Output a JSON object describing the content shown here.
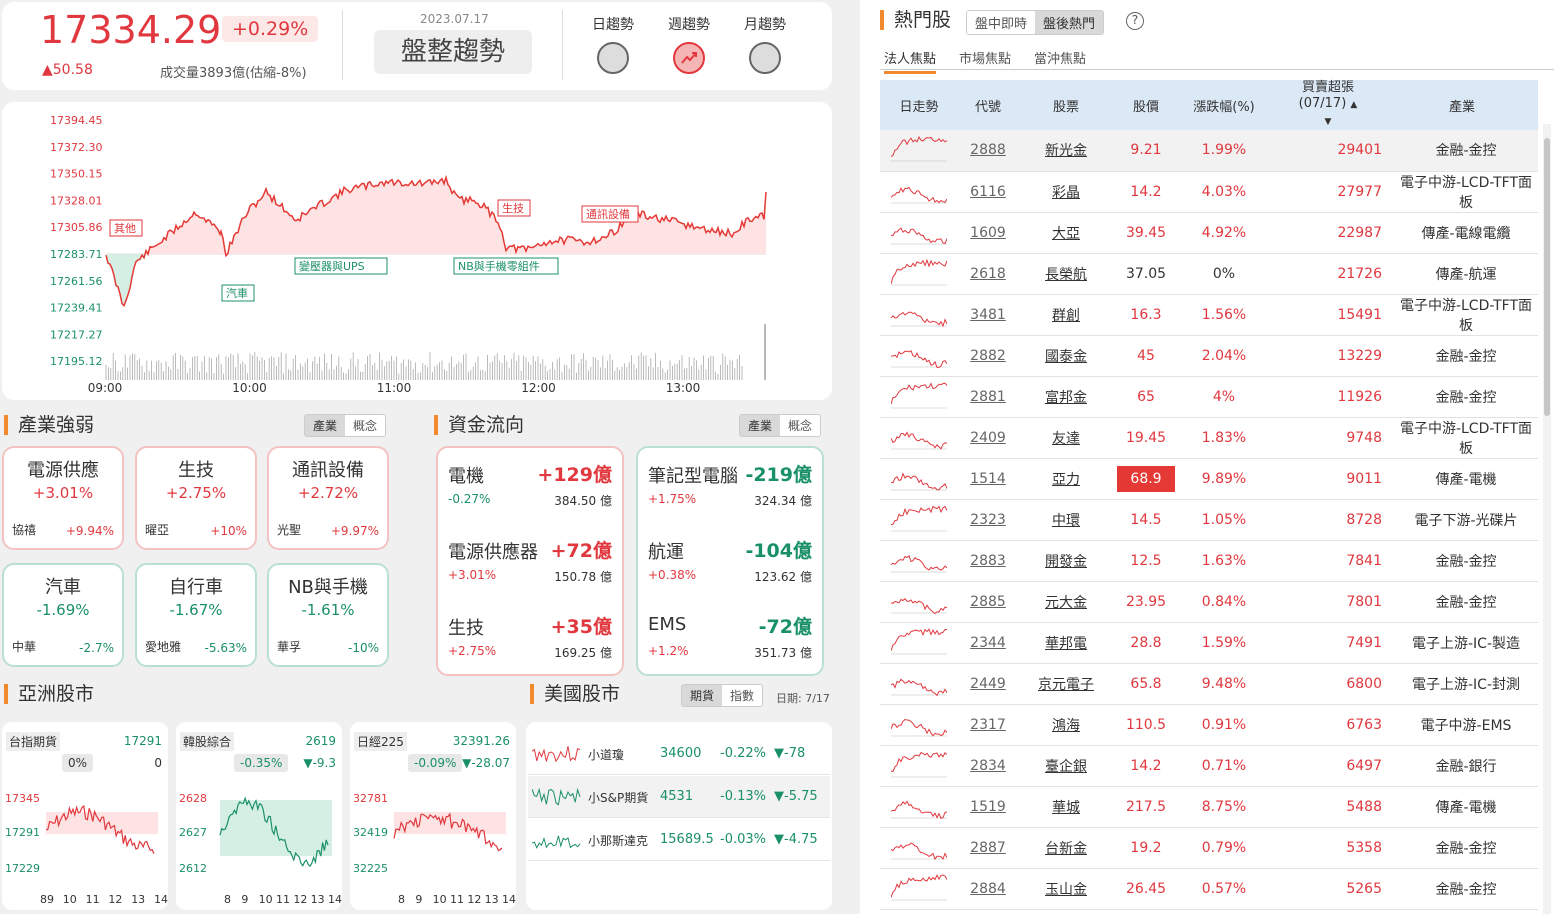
{
  "index": {
    "value": "17334.29",
    "pct": "+0.29%",
    "change": "▲50.58",
    "volume": "成交量3893億(估縮-8%)",
    "date": "2023.07.17",
    "trend_label": "盤整趨勢",
    "trend_tabs": [
      {
        "label": "日趨勢"
      },
      {
        "label": "週趨勢"
      },
      {
        "label": "月趨勢"
      }
    ]
  },
  "intraday": {
    "y_ticks": [
      "17394.45",
      "17372.30",
      "17350.15",
      "17328.01",
      "17305.86",
      "17283.71",
      "17261.56",
      "17239.41",
      "17217.27",
      "17195.12"
    ],
    "x_ticks": [
      "09:00",
      "10:00",
      "11:00",
      "12:00",
      "13:00"
    ],
    "annotations": [
      "其他",
      "汽車",
      "變壓器與UPS",
      "NB與手機零組件",
      "生技",
      "通訊設備"
    ]
  },
  "industry": {
    "title": "產業強弱",
    "tabs": [
      "產業",
      "概念"
    ],
    "items": [
      {
        "name": "電源供應",
        "pct": "+3.01%",
        "stock": "協禧",
        "spct": "+9.94%",
        "dir": "up"
      },
      {
        "name": "生技",
        "pct": "+2.75%",
        "stock": "曜亞",
        "spct": "+10%",
        "dir": "up"
      },
      {
        "name": "通訊設備",
        "pct": "+2.72%",
        "stock": "光聖",
        "spct": "+9.97%",
        "dir": "up"
      },
      {
        "name": "汽車",
        "pct": "-1.69%",
        "stock": "中華",
        "spct": "-2.7%",
        "dir": "dn"
      },
      {
        "name": "自行車",
        "pct": "-1.67%",
        "stock": "愛地雅",
        "spct": "-5.63%",
        "dir": "dn"
      },
      {
        "name": "NB與手機",
        "pct": "-1.61%",
        "stock": "華孚",
        "spct": "-10%",
        "dir": "dn"
      }
    ]
  },
  "flow": {
    "title": "資金流向",
    "tabs": [
      "產業",
      "概念"
    ],
    "in": [
      {
        "name": "電機",
        "amt": "+129億",
        "pct": "-0.27%",
        "vol": "384.50 億"
      },
      {
        "name": "電源供應器",
        "amt": "+72億",
        "pct": "+3.01%",
        "vol": "150.78 億"
      },
      {
        "name": "生技",
        "amt": "+35億",
        "pct": "+2.75%",
        "vol": "169.25 億"
      }
    ],
    "out": [
      {
        "name": "筆記型電腦",
        "amt": "-219億",
        "pct": "+1.75%",
        "vol": "324.34 億"
      },
      {
        "name": "航運",
        "amt": "-104億",
        "pct": "+0.38%",
        "vol": "123.62 億"
      },
      {
        "name": "EMS",
        "amt": "-72億",
        "pct": "+1.2%",
        "vol": "351.73 億"
      }
    ]
  },
  "asia": {
    "title": "亞洲股市",
    "markets": [
      {
        "name": "台指期貨",
        "price": "17291",
        "pct": "0%",
        "chg": "0",
        "y": [
          "17345",
          "17291",
          "17229"
        ],
        "x": [
          "89",
          "10",
          "11",
          "12",
          "13",
          "14"
        ]
      },
      {
        "name": "韓股綜合",
        "price": "2619",
        "pct": "-0.35%",
        "chg": "▼-9.3",
        "y": [
          "2628",
          "2627",
          "2612"
        ],
        "x": [
          "8",
          "9",
          "10",
          "11",
          "12",
          "13",
          "14"
        ]
      },
      {
        "name": "日經225",
        "price": "32391.26",
        "pct": "-0.09%",
        "chg": "▼-28.07",
        "y": [
          "32781",
          "32419",
          "32225"
        ],
        "x": [
          "8",
          "9",
          "10",
          "11",
          "12",
          "13",
          "14"
        ]
      }
    ]
  },
  "us": {
    "title": "美國股市",
    "tabs": [
      "期貨",
      "指數"
    ],
    "date": "日期: 7/17",
    "rows": [
      {
        "name": "小道瓊",
        "price": "34600",
        "pct": "-0.22%",
        "chg": "▼-78"
      },
      {
        "name": "小S&P期貨",
        "price": "4531",
        "pct": "-0.13%",
        "chg": "▼-5.75"
      },
      {
        "name": "小那斯達克",
        "price": "15689.5",
        "pct": "-0.03%",
        "chg": "▼-4.75"
      }
    ]
  },
  "hot": {
    "title": "熱門股",
    "mode_tabs": [
      "盤中即時",
      "盤後熱門"
    ],
    "help": "?",
    "sub_tabs": [
      "法人焦點",
      "市場焦點",
      "當沖焦點"
    ],
    "headers": [
      "日走勢",
      "代號",
      "股票",
      "股價",
      "漲跌幅(%)",
      "買賣超張\n(07/17)",
      "產業"
    ],
    "rows": [
      {
        "code": "2888",
        "name": "新光金",
        "price": "9.21",
        "pct": "1.99%",
        "vol": "29401",
        "sect": "金融-金控"
      },
      {
        "code": "6116",
        "name": "彩晶",
        "price": "14.2",
        "pct": "4.03%",
        "vol": "27977",
        "sect": "電子中游-LCD-TFT面板"
      },
      {
        "code": "1609",
        "name": "大亞",
        "price": "39.45",
        "pct": "4.92%",
        "vol": "22987",
        "sect": "傳產-電線電纜"
      },
      {
        "code": "2618",
        "name": "長榮航",
        "price": "37.05",
        "pct": "0%",
        "vol": "21726",
        "sect": "傳產-航運"
      },
      {
        "code": "3481",
        "name": "群創",
        "price": "16.3",
        "pct": "1.56%",
        "vol": "15491",
        "sect": "電子中游-LCD-TFT面板"
      },
      {
        "code": "2882",
        "name": "國泰金",
        "price": "45",
        "pct": "2.04%",
        "vol": "13229",
        "sect": "金融-金控"
      },
      {
        "code": "2881",
        "name": "富邦金",
        "price": "65",
        "pct": "4%",
        "vol": "11926",
        "sect": "金融-金控"
      },
      {
        "code": "2409",
        "name": "友達",
        "price": "19.45",
        "pct": "1.83%",
        "vol": "9748",
        "sect": "電子中游-LCD-TFT面板"
      },
      {
        "code": "1514",
        "name": "亞力",
        "price": "68.9",
        "pct": "9.89%",
        "vol": "9011",
        "sect": "傳產-電機"
      },
      {
        "code": "2323",
        "name": "中環",
        "price": "14.5",
        "pct": "1.05%",
        "vol": "8728",
        "sect": "電子下游-光碟片"
      },
      {
        "code": "2883",
        "name": "開發金",
        "price": "12.5",
        "pct": "1.63%",
        "vol": "7841",
        "sect": "金融-金控"
      },
      {
        "code": "2885",
        "name": "元大金",
        "price": "23.95",
        "pct": "0.84%",
        "vol": "7801",
        "sect": "金融-金控"
      },
      {
        "code": "2344",
        "name": "華邦電",
        "price": "28.8",
        "pct": "1.59%",
        "vol": "7491",
        "sect": "電子上游-IC-製造"
      },
      {
        "code": "2449",
        "name": "京元電子",
        "price": "65.8",
        "pct": "9.48%",
        "vol": "6800",
        "sect": "電子上游-IC-封測"
      },
      {
        "code": "2317",
        "name": "鴻海",
        "price": "110.5",
        "pct": "0.91%",
        "vol": "6763",
        "sect": "電子中游-EMS"
      },
      {
        "code": "2834",
        "name": "臺企銀",
        "price": "14.2",
        "pct": "0.71%",
        "vol": "6497",
        "sect": "金融-銀行"
      },
      {
        "code": "1519",
        "name": "華城",
        "price": "217.5",
        "pct": "8.75%",
        "vol": "5488",
        "sect": "傳產-電機"
      },
      {
        "code": "2887",
        "name": "台新金",
        "price": "19.2",
        "pct": "0.79%",
        "vol": "5358",
        "sect": "金融-金控"
      },
      {
        "code": "2884",
        "name": "玉山金",
        "price": "26.45",
        "pct": "0.57%",
        "vol": "5265",
        "sect": "金融-金控"
      }
    ]
  }
}
